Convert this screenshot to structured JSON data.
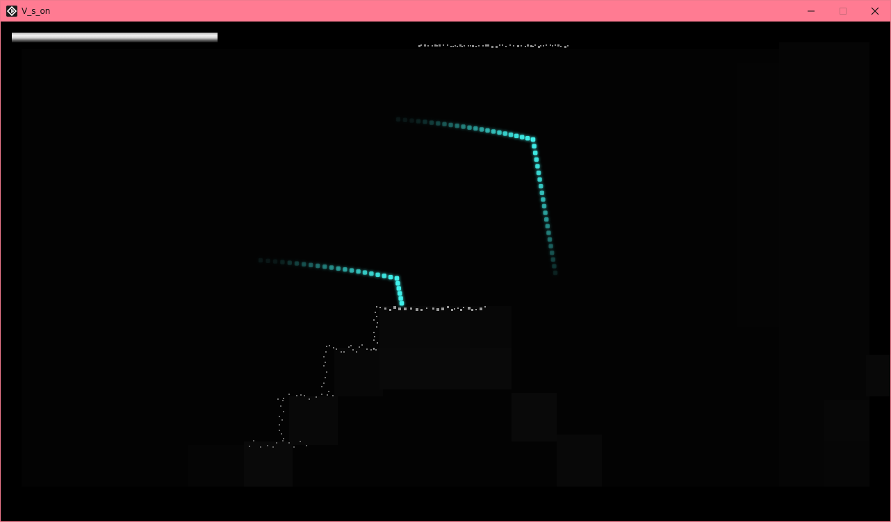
{
  "window": {
    "title": "V_s_on",
    "titlebar_color": "#ff7b92",
    "icons": [
      "app-icon",
      "minimize-icon",
      "maximize-icon",
      "close-icon"
    ]
  },
  "hud": {
    "health_fraction": 1.0,
    "health_color": "#e6e6e6"
  },
  "scene": {
    "background_color": "#000000",
    "trail_color": "#3ff0ea",
    "particle_color": "#bdbdbd"
  }
}
